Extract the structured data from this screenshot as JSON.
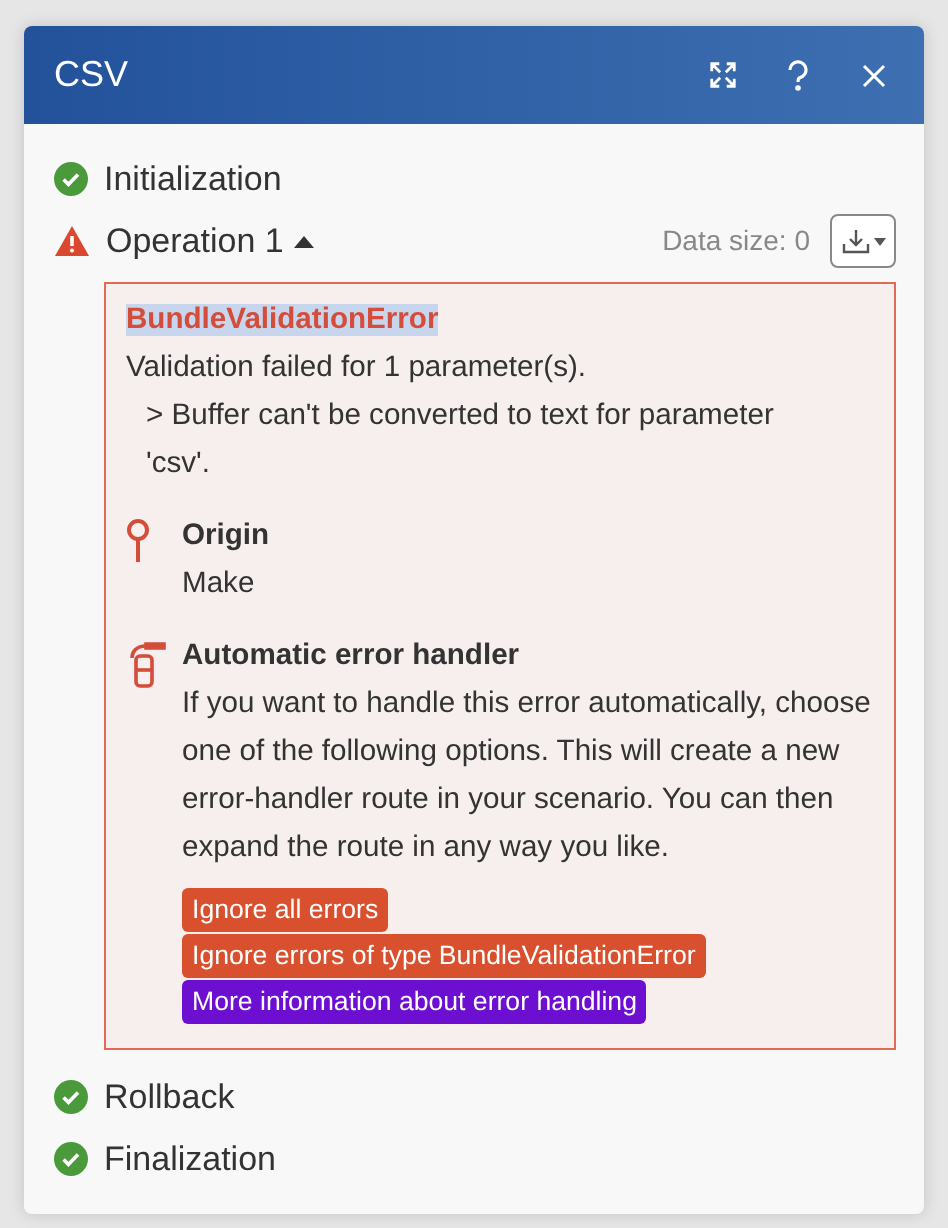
{
  "window": {
    "title": "CSV"
  },
  "stages": [
    {
      "name": "Initialization",
      "kind": "success"
    },
    {
      "name": "Operation 1",
      "kind": "error",
      "expanded": true,
      "data_size": "Data size: 0",
      "error": {
        "title": "BundleValidationError",
        "message": "Validation failed for 1 parameter(s).",
        "detail": "> Buffer can't be converted to text for parameter 'csv'.",
        "sections": [
          {
            "kind": "origin",
            "heading": "Origin",
            "text": "Make"
          },
          {
            "kind": "handler",
            "heading": "Automatic error handler",
            "text": "If you want to handle this error automatically, choose one of the following options. This will create a new error-handler route in your scenario. You can then expand the route in any way you like."
          }
        ],
        "actions": [
          {
            "label": "Ignore all errors",
            "kind": "ignore"
          },
          {
            "label": "Ignore errors of type BundleValidationError",
            "kind": "ignore"
          },
          {
            "label": "More information about error handling",
            "kind": "info"
          }
        ]
      }
    },
    {
      "name": "Rollback",
      "kind": "success"
    },
    {
      "name": "Finalization",
      "kind": "success"
    }
  ]
}
